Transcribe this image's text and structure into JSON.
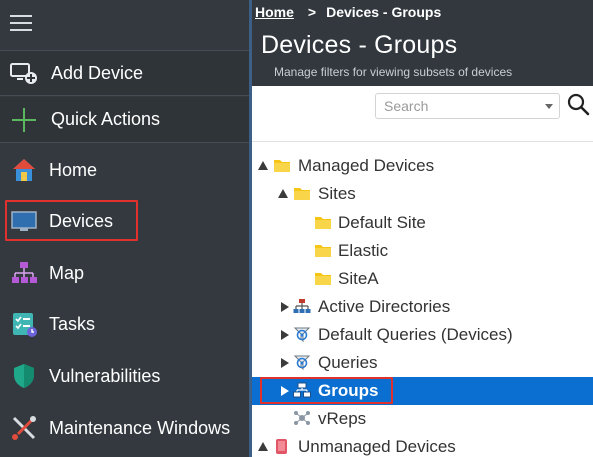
{
  "sidebar": {
    "menu_icon": "hamburger-menu-icon",
    "actions": [
      {
        "label": "Add Device",
        "icon": "add-device-icon"
      },
      {
        "label": "Quick Actions",
        "icon": "plus-icon"
      }
    ],
    "items": [
      {
        "label": "Home",
        "icon": "home-icon"
      },
      {
        "label": "Devices",
        "icon": "monitor-icon",
        "highlighted": true
      },
      {
        "label": "Map",
        "icon": "network-map-icon"
      },
      {
        "label": "Tasks",
        "icon": "tasks-checklist-icon"
      },
      {
        "label": "Vulnerabilities",
        "icon": "shield-icon"
      },
      {
        "label": "Maintenance Windows",
        "icon": "tools-icon"
      }
    ]
  },
  "breadcrumb": {
    "home": "Home",
    "separator": ">",
    "current": "Devices - Groups"
  },
  "header": {
    "title": "Devices - Groups",
    "subtitle": "Manage filters for viewing subsets of devices"
  },
  "search": {
    "placeholder": "Search",
    "value": ""
  },
  "tree": [
    {
      "label": "Managed Devices",
      "state": "expanded",
      "icon": "folder-icon"
    },
    {
      "label": "Sites",
      "state": "expanded",
      "icon": "folder-icon"
    },
    {
      "label": "Default Site",
      "state": "leaf",
      "icon": "folder-icon"
    },
    {
      "label": "Elastic",
      "state": "leaf",
      "icon": "folder-icon"
    },
    {
      "label": "SiteA",
      "state": "leaf",
      "icon": "folder-icon"
    },
    {
      "label": "Active Directories",
      "state": "collapsed",
      "icon": "active-directory-icon"
    },
    {
      "label": "Default Queries (Devices)",
      "state": "collapsed",
      "icon": "query-icon"
    },
    {
      "label": "Queries",
      "state": "collapsed",
      "icon": "query-icon"
    },
    {
      "label": "Groups",
      "state": "collapsed",
      "icon": "groups-icon",
      "selected": true
    },
    {
      "label": "vReps",
      "state": "leaf",
      "icon": "vreps-icon"
    },
    {
      "label": "Unmanaged Devices",
      "state": "expanded",
      "icon": "unmanaged-devices-icon"
    }
  ],
  "colors": {
    "sidebar_bg": "#33393f",
    "header_bg": "#32383d",
    "selection_blue": "#0a6fd0",
    "highlight_red": "#e0312c",
    "folder_yellow": "#f5c518"
  }
}
